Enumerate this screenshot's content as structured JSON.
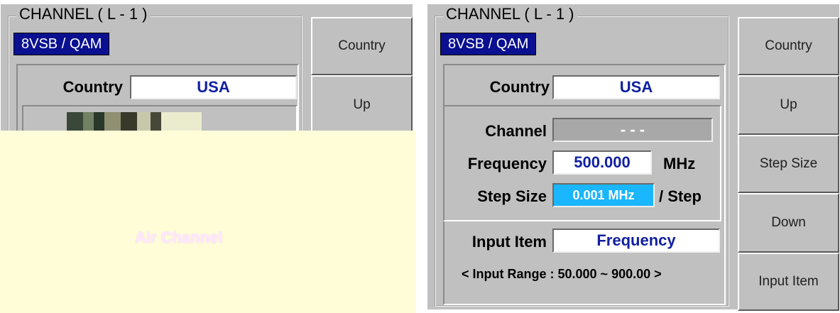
{
  "left_panel": {
    "group_title": "CHANNEL ( L - 1 )",
    "mode": "8VSB / QAM",
    "country_label": "Country",
    "country_value": "USA",
    "softkeys": [
      "Country",
      "Up"
    ],
    "overlay_text": "Air Channel"
  },
  "right_panel": {
    "group_title": "CHANNEL ( L - 1 )",
    "mode": "8VSB / QAM",
    "country_label": "Country",
    "country_value": "USA",
    "channel_label": "Channel",
    "channel_value": "- - -",
    "frequency_label": "Frequency",
    "frequency_value": "500.000",
    "frequency_unit": "MHz",
    "step_label": "Step Size",
    "step_value": "0.001 MHz",
    "step_unit": "/ Step",
    "input_item_label": "Input Item",
    "input_item_value": "Frequency",
    "range_note": "< Input Range : 50.000 ~ 900.00 >",
    "softkeys": [
      "Country",
      "Up",
      "Step Size",
      "Down",
      "Input Item"
    ]
  },
  "colors": {
    "panel_bg": "#c0c0c0",
    "badge_bg": "#0a1090",
    "value_text": "#1020a0",
    "highlight_field": "#1ab6ff",
    "overlay_bg": "#fffdd8"
  }
}
